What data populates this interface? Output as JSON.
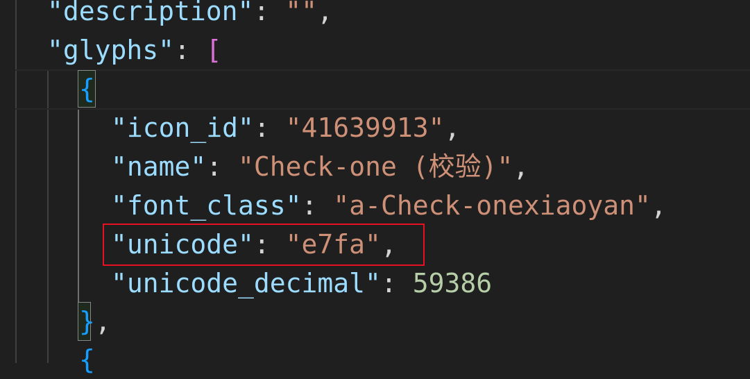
{
  "editor": {
    "lines": [
      {
        "key": "\"description\"",
        "sep": ": ",
        "value": "\"\"",
        "tail": ","
      },
      {
        "key": "\"glyphs\"",
        "sep": ": ",
        "bracket": "["
      },
      {
        "brace": "{"
      },
      {
        "key": "\"icon_id\"",
        "sep": ": ",
        "value": "\"41639913\"",
        "tail": ","
      },
      {
        "key": "\"name\"",
        "sep": ": ",
        "value": "\"Check-one (校验)\"",
        "tail": ","
      },
      {
        "key": "\"font_class\"",
        "sep": ": ",
        "value": "\"a-Check-onexiaoyan\"",
        "tail": ","
      },
      {
        "key": "\"unicode\"",
        "sep": ": ",
        "value": "\"e7fa\"",
        "tail": ","
      },
      {
        "key": "\"unicode_decimal\"",
        "sep": ": ",
        "number": "59386"
      },
      {
        "brace": "}",
        "tail": ","
      },
      {
        "brace": "{"
      }
    ]
  },
  "highlight": {
    "color": "#e81123",
    "target": "unicode"
  }
}
